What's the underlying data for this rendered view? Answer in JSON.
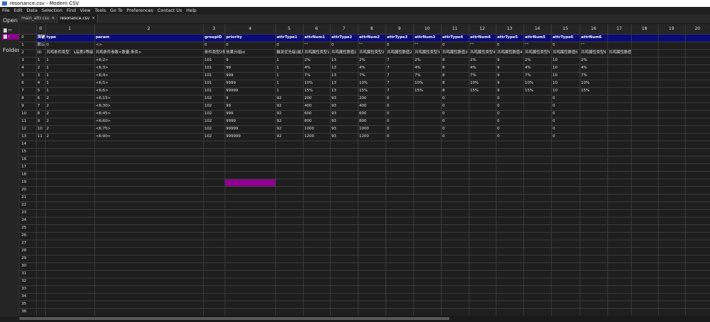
{
  "window": {
    "title": "resonance.csv - Modern CSV"
  },
  "menu": [
    "File",
    "Edit",
    "Data",
    "Selection",
    "Find",
    "View",
    "Tools",
    "Go To",
    "Preferences",
    "Contact Us",
    "Help"
  ],
  "sidebar": {
    "open_label": "Open",
    "folders_label": "Folder",
    "files": [
      "m",
      "r"
    ]
  },
  "tabs": [
    {
      "label": "main_attr.csv",
      "active": false
    },
    {
      "label": "resonance.csv",
      "active": true
    }
  ],
  "columns": [
    "0",
    "1",
    "2",
    "3",
    "4",
    "5",
    "6",
    "7",
    "8",
    "9",
    "10",
    "11",
    "12",
    "13",
    "14",
    "15",
    "16",
    "17",
    "18",
    "19",
    "20"
  ],
  "rows": [
    [
      "突破名",
      "type",
      "param",
      "groupID",
      "priority",
      "attrType1",
      "attrNum1",
      "attrType2",
      "attrNum2",
      "attrType3",
      "attrNum3",
      "attrType4",
      "attrNum4",
      "attrType5",
      "attrNum5",
      "attrType6",
      "attrNum6"
    ],
    [
      "默认值",
      "0",
      "<>",
      "0",
      "0",
      "0",
      "\"\"",
      "0",
      "\"\"",
      "0",
      "\"\"",
      "0",
      "\"\"",
      "0",
      "\"\"",
      "0",
      "\"\""
    ],
    [
      "ID",
      "共鸣条件类型：1品质2等级",
      "共鸣条件参数<数量;条件>",
      "条件类型2条件值大于等于条件数值",
      "效果分组id",
      "触发优先级(越大优先级越低)",
      "共鸣属性类型1",
      "共鸣属性数值1",
      "共鸣属性类型2",
      "共鸣属性数值2",
      "共鸣属性类型3",
      "共鸣属性数值3",
      "共鸣属性类型4",
      "共鸣属性数值4",
      "共鸣属性类型5",
      "共鸣属性数值5",
      "共鸣属性类型6",
      "共鸣属性数值6"
    ],
    [
      "1",
      "1",
      "<6;2>",
      "101",
      "9",
      "1",
      "2%",
      "13",
      "2%",
      "7",
      "2%",
      "8",
      "2%",
      "9",
      "2%",
      "10",
      "2%"
    ],
    [
      "2",
      "1",
      "<6;3>",
      "101",
      "99",
      "1",
      "4%",
      "13",
      "4%",
      "7",
      "4%",
      "8",
      "4%",
      "9",
      "4%",
      "10",
      "4%"
    ],
    [
      "3",
      "1",
      "<6;4>",
      "101",
      "999",
      "1",
      "7%",
      "13",
      "7%",
      "7",
      "7%",
      "8",
      "7%",
      "9",
      "7%",
      "10",
      "7%"
    ],
    [
      "4",
      "1",
      "<6;5>",
      "101",
      "9999",
      "1",
      "10%",
      "13",
      "10%",
      "7",
      "10%",
      "8",
      "10%",
      "9",
      "10%",
      "10",
      "10%"
    ],
    [
      "5",
      "1",
      "<6;6>",
      "101",
      "99999",
      "1",
      "15%",
      "13",
      "15%",
      "7",
      "15%",
      "8",
      "15%",
      "9",
      "15%",
      "10",
      "15%"
    ],
    [
      "6",
      "2",
      "<6;15>",
      "102",
      "9",
      "92",
      "200",
      "93",
      "200",
      "0",
      "",
      "0",
      "",
      "0",
      "",
      "0",
      ""
    ],
    [
      "7",
      "2",
      "<6;30>",
      "102",
      "99",
      "92",
      "400",
      "93",
      "400",
      "0",
      "",
      "0",
      "",
      "0",
      "",
      "0",
      ""
    ],
    [
      "8",
      "2",
      "<6;45>",
      "102",
      "999",
      "92",
      "600",
      "93",
      "600",
      "0",
      "",
      "0",
      "",
      "0",
      "",
      "0",
      ""
    ],
    [
      "9",
      "2",
      "<6;60>",
      "102",
      "9999",
      "92",
      "800",
      "93",
      "800",
      "0",
      "",
      "0",
      "",
      "0",
      "",
      "0",
      ""
    ],
    [
      "10",
      "2",
      "<6;75>",
      "102",
      "99999",
      "92",
      "1000",
      "93",
      "1000",
      "0",
      "",
      "0",
      "",
      "0",
      "",
      "0",
      ""
    ],
    [
      "11",
      "2",
      "<6;90>",
      "102",
      "999999",
      "92",
      "1200",
      "93",
      "1200",
      "0",
      "",
      "0",
      "",
      "0",
      "",
      "0",
      ""
    ]
  ],
  "row_numbers": [
    "0",
    "1",
    "2",
    "3",
    "4",
    "5",
    "6",
    "7",
    "8",
    "9",
    "10",
    "11",
    "12",
    "13",
    "14",
    "15",
    "16",
    "17",
    "18",
    "19",
    "20",
    "21",
    "22",
    "23",
    "24",
    "25",
    "26",
    "27",
    "28",
    "29",
    "30",
    "31",
    "32",
    "33",
    "34",
    "35",
    "36"
  ],
  "selected_cell": {
    "row": "19",
    "column": "4"
  },
  "colors": {
    "header_row": "#0a0a78",
    "selection": "#8e008e",
    "background": "#1e1e1e",
    "gridline": "#3a3a3a"
  }
}
